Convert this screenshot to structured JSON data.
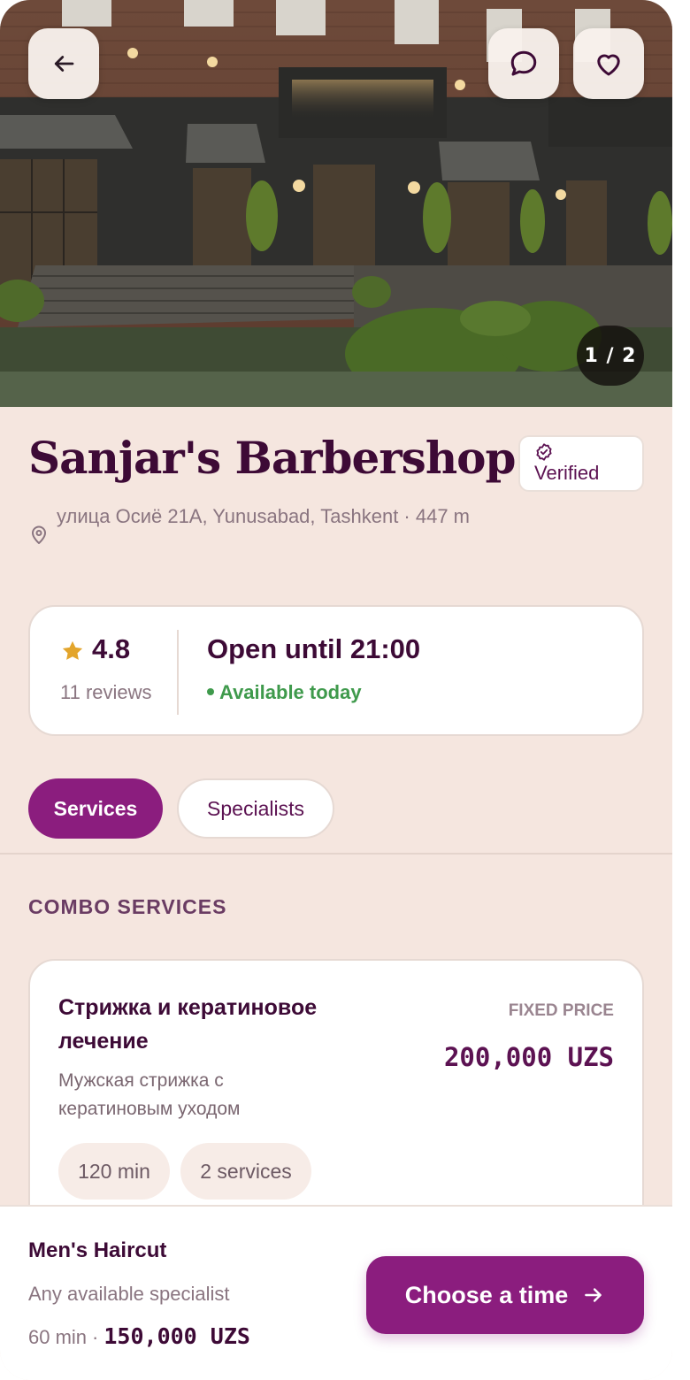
{
  "hero": {
    "counter": "1 / 2",
    "icons": {
      "back": "arrow-left-icon",
      "chat": "chat-bubble-icon",
      "favorite": "heart-icon"
    }
  },
  "shop": {
    "name": "Sanjar's Barbershop",
    "verified_label": "Verified",
    "address": "улица Осиё 21A, Yunusabad, Tashkent · 447 m"
  },
  "summary": {
    "rating": "4.8",
    "reviews": "11 reviews",
    "hours": "Open until 21:00",
    "availability": "Available today"
  },
  "tabs": [
    {
      "label": "Services",
      "active": true
    },
    {
      "label": "Specialists",
      "active": false
    }
  ],
  "section": {
    "heading": "COMBO SERVICES"
  },
  "service": {
    "name": "Стрижка и кератиновое лечение",
    "description": "Мужская стрижка с кератиновым уходом",
    "price_type": "FIXED PRICE",
    "price": "200,000 UZS",
    "chips": [
      "120 min",
      "2 services"
    ]
  },
  "selection": {
    "name": "Men's Haircut",
    "specialist": "Any available specialist",
    "duration": "60 min",
    "separator": "·",
    "price": "150,000 UZS",
    "cta": "Choose a time"
  },
  "colors": {
    "accent": "#8b1d7e",
    "background": "#f5e6df",
    "text": "#3d0a36",
    "available": "#3f9a4c",
    "star": "#e3a52c"
  }
}
